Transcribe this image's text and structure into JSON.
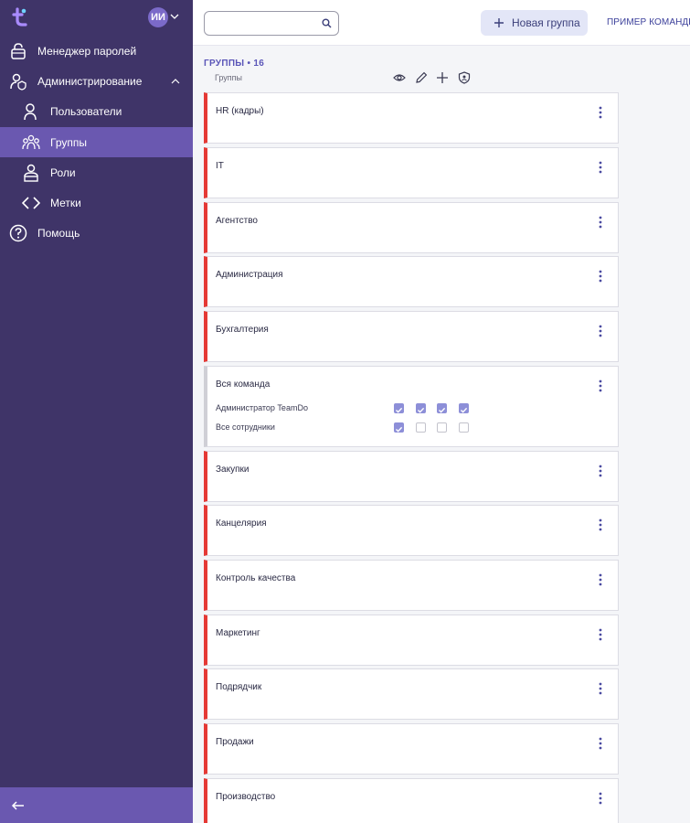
{
  "sidebar": {
    "logo_icon": "teamdo-logo",
    "avatar_initials": "ИИ",
    "items": [
      {
        "label": "Менеджер паролей",
        "icon": "lock-icon"
      },
      {
        "label": "Администрирование",
        "icon": "admin-icon"
      },
      {
        "label": "Пользователи",
        "icon": "user-icon"
      },
      {
        "label": "Группы",
        "icon": "group-icon"
      },
      {
        "label": "Роли",
        "icon": "role-icon"
      },
      {
        "label": "Метки",
        "icon": "tag-icon"
      },
      {
        "label": "Помощь",
        "icon": "help-icon"
      }
    ],
    "active_item": "Группы",
    "footer_icon": "arrow-left-icon"
  },
  "topbar": {
    "search_placeholder": "",
    "new_group_label": "Новая группа",
    "example_link": "ПРИМЕР КОМАНДЫ"
  },
  "groups": {
    "title": "ГРУППЫ • 16",
    "subtitle": "Группы",
    "toolbar_icons": [
      "eye-icon",
      "pencil-icon",
      "plus-icon",
      "shield-icon"
    ],
    "list": [
      {
        "name": "HR (кадры)"
      },
      {
        "name": "IT"
      },
      {
        "name": "Агентство"
      },
      {
        "name": "Администрация"
      },
      {
        "name": "Бухгалтерия"
      },
      {
        "name": "Вся команда",
        "members": [
          {
            "name": "Администратор TeamDo",
            "perms": [
              true,
              true,
              true,
              true
            ]
          },
          {
            "name": "Все сотрудники",
            "perms": [
              true,
              false,
              false,
              false
            ]
          }
        ]
      },
      {
        "name": "Закупки"
      },
      {
        "name": "Канцелярия"
      },
      {
        "name": "Контроль качества"
      },
      {
        "name": "Маркетинг"
      },
      {
        "name": "Подрядчик"
      },
      {
        "name": "Продажи"
      },
      {
        "name": "Производство"
      }
    ]
  },
  "colors": {
    "sidebar_bg": "#3f3468",
    "sidebar_active": "#6a58b0",
    "accent_red": "#e53935",
    "checkbox_on": "#8d8fd8",
    "title_blue": "#5a55b8"
  }
}
